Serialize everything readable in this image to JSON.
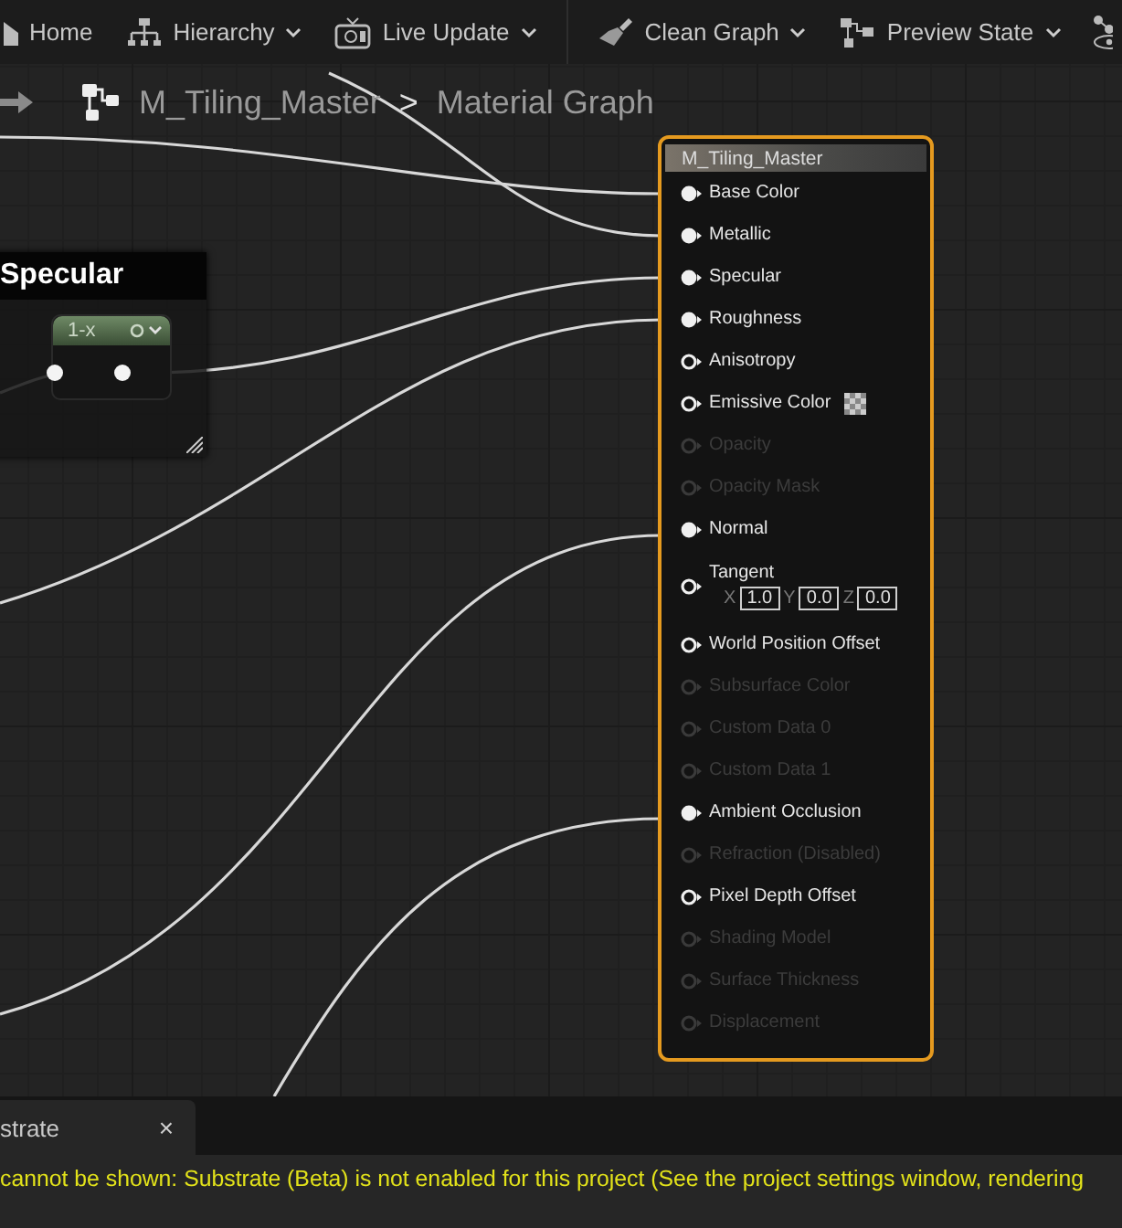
{
  "toolbar": {
    "items": [
      {
        "label": "Home",
        "dropdown": false,
        "separator_before": false
      },
      {
        "label": "Hierarchy",
        "dropdown": true,
        "separator_before": false
      },
      {
        "label": "Live Update",
        "dropdown": true,
        "separator_before": false
      },
      {
        "label": "Clean Graph",
        "dropdown": true,
        "separator_before": true
      },
      {
        "label": "Preview State",
        "dropdown": true,
        "separator_before": false
      }
    ]
  },
  "breadcrumb": {
    "items": [
      "M_Tiling_Master",
      "Material Graph"
    ],
    "separator": ">"
  },
  "comment_node": {
    "title": "Specular",
    "node": {
      "title": "1-x"
    }
  },
  "material_node": {
    "title": "M_Tiling_Master",
    "pins": [
      {
        "label": "Base Color",
        "kind": "plain",
        "connected": true,
        "enabled": true
      },
      {
        "label": "Metallic",
        "kind": "plain",
        "connected": true,
        "enabled": true
      },
      {
        "label": "Specular",
        "kind": "plain",
        "connected": true,
        "enabled": true
      },
      {
        "label": "Roughness",
        "kind": "plain",
        "connected": true,
        "enabled": true
      },
      {
        "label": "Anisotropy",
        "kind": "plain",
        "connected": false,
        "enabled": true
      },
      {
        "label": "Emissive Color",
        "kind": "color",
        "connected": false,
        "enabled": true
      },
      {
        "label": "Opacity",
        "kind": "plain",
        "connected": false,
        "enabled": false
      },
      {
        "label": "Opacity Mask",
        "kind": "plain",
        "connected": false,
        "enabled": false
      },
      {
        "label": "Normal",
        "kind": "plain",
        "connected": true,
        "enabled": true
      },
      {
        "label": "Tangent",
        "kind": "vector",
        "connected": false,
        "enabled": true,
        "fields": [
          {
            "axis": "X",
            "value": "1.0"
          },
          {
            "axis": "Y",
            "value": "0.0"
          },
          {
            "axis": "Z",
            "value": "0.0"
          }
        ]
      },
      {
        "label": "World Position Offset",
        "kind": "plain",
        "connected": false,
        "enabled": true
      },
      {
        "label": "Subsurface Color",
        "kind": "plain",
        "connected": false,
        "enabled": false
      },
      {
        "label": "Custom Data 0",
        "kind": "plain",
        "connected": false,
        "enabled": false
      },
      {
        "label": "Custom Data 1",
        "kind": "plain",
        "connected": false,
        "enabled": false
      },
      {
        "label": "Ambient Occlusion",
        "kind": "plain",
        "connected": true,
        "enabled": true
      },
      {
        "label": "Refraction (Disabled)",
        "kind": "plain",
        "connected": false,
        "enabled": false
      },
      {
        "label": "Pixel Depth Offset",
        "kind": "plain",
        "connected": false,
        "enabled": true
      },
      {
        "label": "Shading Model",
        "kind": "plain",
        "connected": false,
        "enabled": false
      },
      {
        "label": "Surface Thickness",
        "kind": "plain",
        "connected": false,
        "enabled": false
      },
      {
        "label": "Displacement",
        "kind": "plain",
        "connected": false,
        "enabled": false
      }
    ]
  },
  "bottom_tab": {
    "label": "strate",
    "close": "×"
  },
  "message": "cannot be shown: Substrate (Beta) is not enabled for this project (See the project settings window, rendering"
}
